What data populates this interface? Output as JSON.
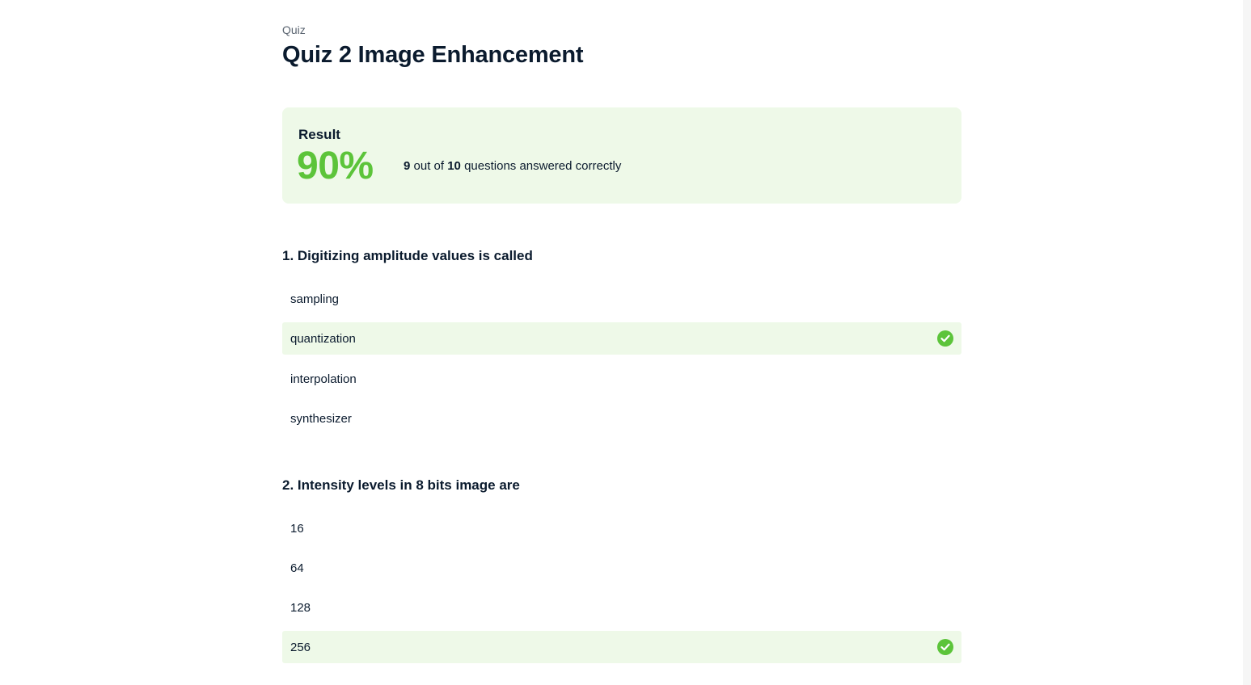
{
  "header": {
    "breadcrumb": "Quiz",
    "title": "Quiz 2 Image Enhancement"
  },
  "result": {
    "label": "Result",
    "percent": "90%",
    "correct_count": "9",
    "out_of_text": " out of ",
    "total_count": "10",
    "suffix_text": " questions answered correctly"
  },
  "questions": [
    {
      "title": "1. Digitizing amplitude values is called",
      "options": [
        {
          "label": "sampling",
          "correct": false
        },
        {
          "label": "quantization",
          "correct": true
        },
        {
          "label": "interpolation",
          "correct": false
        },
        {
          "label": "synthesizer",
          "correct": false
        }
      ]
    },
    {
      "title": "2. Intensity levels in 8 bits image are",
      "options": [
        {
          "label": "16",
          "correct": false
        },
        {
          "label": "64",
          "correct": false
        },
        {
          "label": "128",
          "correct": false
        },
        {
          "label": "256",
          "correct": true
        }
      ]
    }
  ],
  "colors": {
    "accent_green": "#5cc43a",
    "highlight_bg": "#eef9e8",
    "text_dark": "#0b1b2e"
  },
  "icons": {
    "correct": "check-circle-icon"
  }
}
